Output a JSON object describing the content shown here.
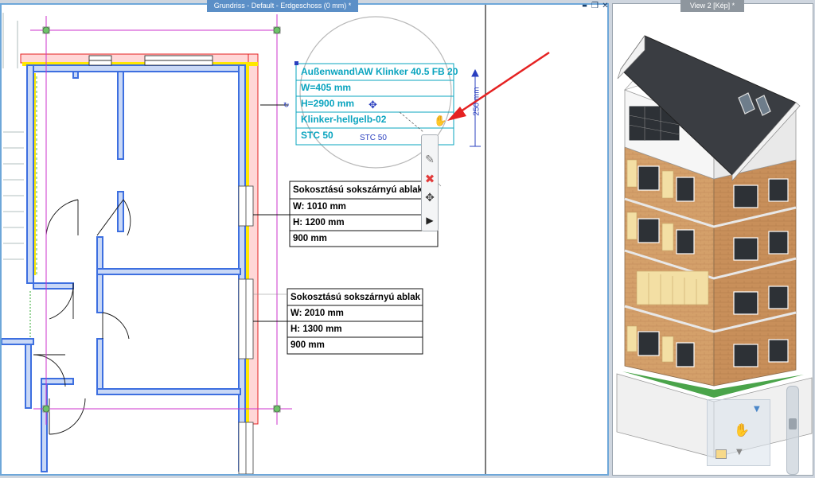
{
  "views": {
    "left_title": "Grundriss - Default - Erdgeschoss (0 mm) *",
    "right_title": "View 2 [Kép] *"
  },
  "window_controls": {
    "minimize": "▬",
    "maximize": "❐",
    "close": "✕"
  },
  "wall_label": {
    "line1": "Außenwand\\AW Klinker 40.5 FB 20",
    "line2": "W=405 mm",
    "line3": "H=2900 mm",
    "line4": "Klinker-hellgelb-02",
    "line5": "STC 50",
    "stc_small": "STC 50"
  },
  "dimension": {
    "text": "250 mm"
  },
  "window_label_1": {
    "name": "Sokosztású sokszárnyú ablak",
    "w": "W: 1010 mm",
    "h": "H: 1200 mm",
    "sill": "900 mm"
  },
  "window_label_2": {
    "name": "Sokosztású sokszárnyú ablak",
    "w": "W: 2010 mm",
    "h": "H: 1300 mm",
    "sill": "900 mm"
  },
  "colors": {
    "wall_blue": "#3d6fe0",
    "wall_fill": "#c9d8f6",
    "yellow": "#ffe800",
    "red_hatch": "#e52222",
    "cyan": "#0aa4bf",
    "magenta": "#cc33cc",
    "accent": "#5b8fc7",
    "brick": "#d4a06a",
    "roof": "#3a3d42"
  },
  "toolbox": {
    "edit_icon": "pencil-icon",
    "delete_icon": "delete-x-icon",
    "move_icon": "move-icon",
    "more_icon": "play-arrow-icon"
  }
}
